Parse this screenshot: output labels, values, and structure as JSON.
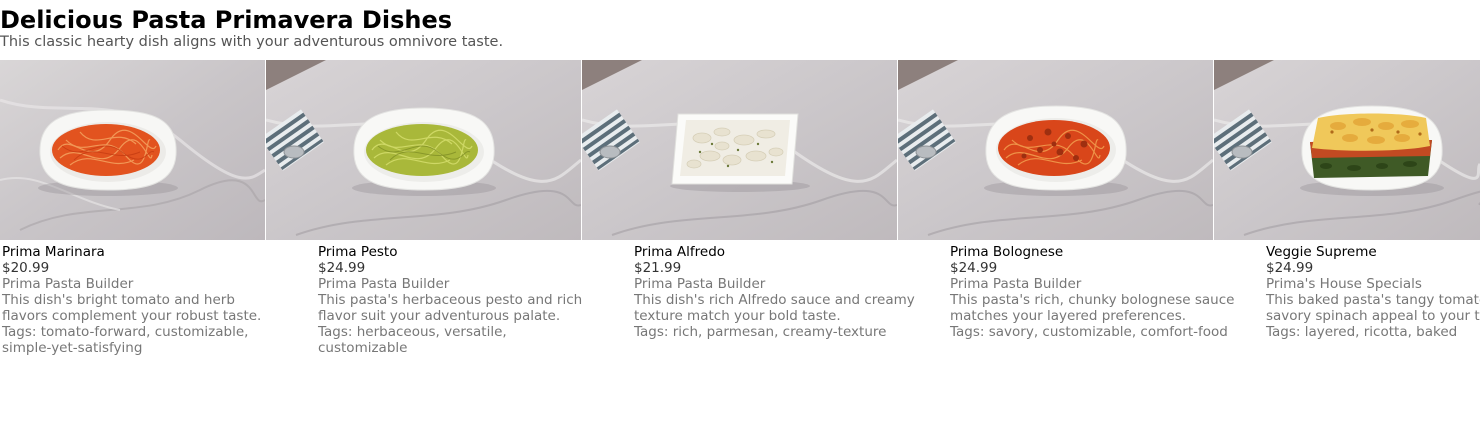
{
  "page": {
    "title": "Delicious Pasta Primavera Dishes",
    "subtitle": "This classic hearty dish aligns with your adventurous omnivore taste."
  },
  "dishes": [
    {
      "name": "Prima Marinara",
      "price": "$20.99",
      "maker": "Prima Pasta Builder",
      "description": "This dish's bright tomato and herb flavors complement your robust taste.",
      "tags": "Tags: tomato-forward, customizable, simple-yet-satisfying",
      "image": "marinara-spaghetti-in-white-bowl"
    },
    {
      "name": "Prima Pesto",
      "price": "$24.99",
      "maker": "Prima Pasta Builder",
      "description": "This pasta's herbaceous pesto and rich flavor suit your adventurous palate.",
      "tags": "Tags: herbaceous, versatile, customizable",
      "image": "pesto-spaghetti-in-white-bowl"
    },
    {
      "name": "Prima Alfredo",
      "price": "$21.99",
      "maker": "Prima Pasta Builder",
      "description": "This dish's rich Alfredo sauce and creamy texture match your bold taste.",
      "tags": "Tags: rich, parmesan, creamy-texture",
      "image": "alfredo-pasta-on-square-plate"
    },
    {
      "name": "Prima Bolognese",
      "price": "$24.99",
      "maker": "Prima Pasta Builder",
      "description": "This pasta's rich, chunky bolognese sauce matches your layered preferences.",
      "tags": "Tags: savory, customizable, comfort-food",
      "image": "bolognese-spaghetti-in-white-bowl"
    },
    {
      "name": "Veggie Supreme",
      "price": "$24.99",
      "maker": "Prima's House Specials",
      "description": "This baked pasta's tangy tomato and savory spinach appeal to your taste.",
      "tags": "Tags: layered, ricotta, baked",
      "image": "baked-lasagna-with-spinach"
    }
  ]
}
